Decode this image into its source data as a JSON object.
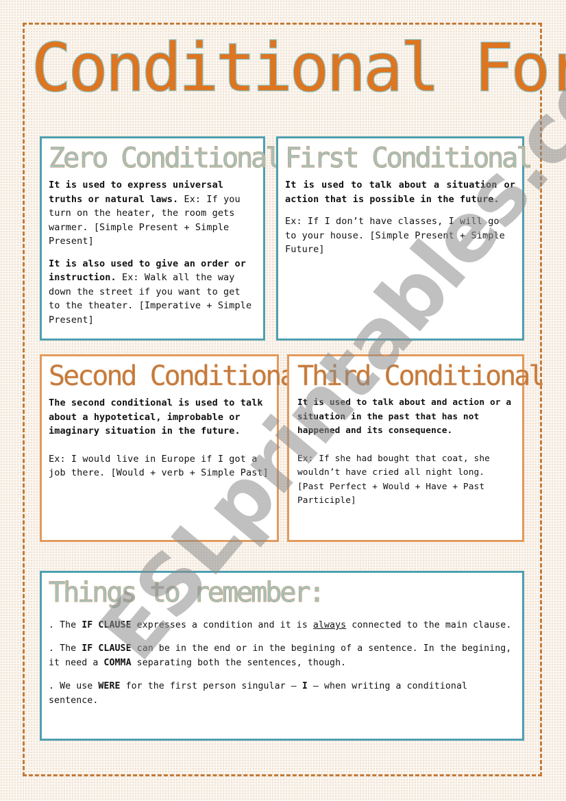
{
  "title": "Conditional Forms",
  "colors": {
    "accent_orange": "#dd7521",
    "accent_teal": "#4f9fb0",
    "frame_dash": "#c27a38",
    "card_orange_border": "#e39a5c"
  },
  "cards": {
    "zero": {
      "title": "Zero Conditional",
      "p1_bold": "It is used to express universal truths or natural laws.",
      "p1_rest": " Ex: If you turn on the heater, the room gets warmer.  [Simple Present + Simple Present]",
      "p2_bold": "It is also used to give an order or instruction.",
      "p2_rest": " Ex: Walk all the way down the street if you want to get to the theater. [Imperative + Simple Present]"
    },
    "first": {
      "title": "First Conditional",
      "p1_bold": "It is used to talk about a situation or action that is possible in the future.",
      "p2": "Ex:  If I don’t have classes, I will go to your house. [Simple Present + Simple Future]"
    },
    "second": {
      "title": "Second Conditional",
      "p1_bold": "The second conditional is used to talk about a hypotetical, improbable or imaginary situation in the future.",
      "p2": "Ex: I would live in Europe if I got a job there. [Would + verb + Simple Past]"
    },
    "third": {
      "title": "Third Conditional",
      "p1_bold": "It is used to talk about and action or a situation in the past that has not happened and its consequence.",
      "p2": "Ex: If she had bought that coat, she wouldn’t have cried all night long. [Past Perfect + Would + Have + Past Participle]"
    }
  },
  "remember": {
    "title": "Things to remember:",
    "items": [
      {
        "t1": ". The ",
        "b1": "IF CLAUSE",
        "t2": " expresses a condition and it is ",
        "u1": "always",
        "t3": " connected to the main clause."
      },
      {
        "t1": ". The ",
        "b1": "IF CLAUSE",
        "t2": " can be in the end or in the begining of a sentence. In the begining, it need a ",
        "b2": "COMMA",
        "t3": " separating both the sentences, though."
      },
      {
        "t1": ". We use ",
        "b1": "WERE",
        "t2": " for the first person singular – ",
        "b2": "I",
        "t3": " – when writing a conditional sentence."
      }
    ]
  },
  "watermark": "ESLprintables.com"
}
